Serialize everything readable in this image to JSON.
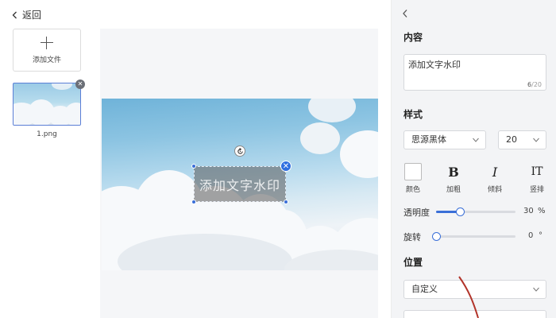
{
  "header": {
    "back_label": "返回"
  },
  "files": {
    "add_label": "添加文件",
    "items": [
      {
        "name": "1.png"
      }
    ]
  },
  "watermark": {
    "text": "添加文字水印"
  },
  "panel": {
    "content_title": "内容",
    "content_value": "添加文字水印",
    "char_count": "6",
    "char_max": "/20",
    "style_title": "样式",
    "font_family": "思源黑体",
    "font_size": "20",
    "buttons": {
      "color": "颜色",
      "bold_glyph": "B",
      "bold": "加粗",
      "italic_glyph": "I",
      "italic": "倾斜",
      "vertical_glyph": "IT",
      "vertical": "竖排"
    },
    "opacity_label": "透明度",
    "opacity_value": "30",
    "opacity_unit": "%",
    "opacity_level": 0.3,
    "rotate_label": "旋转",
    "rotate_value": "0",
    "rotate_unit": "°",
    "position_title": "位置",
    "position_value": "自定义"
  },
  "colors": {
    "accent": "#3a6fd8",
    "panel_bg": "#f3f4f6",
    "annotation_arrow": "#b2342a"
  },
  "icons": {
    "back": "chevron-left-icon",
    "collapse": "chevron-left-icon",
    "add": "plus-icon",
    "remove": "close-icon",
    "rotate": "rotate-icon",
    "dropdown": "chevron-down-icon"
  }
}
